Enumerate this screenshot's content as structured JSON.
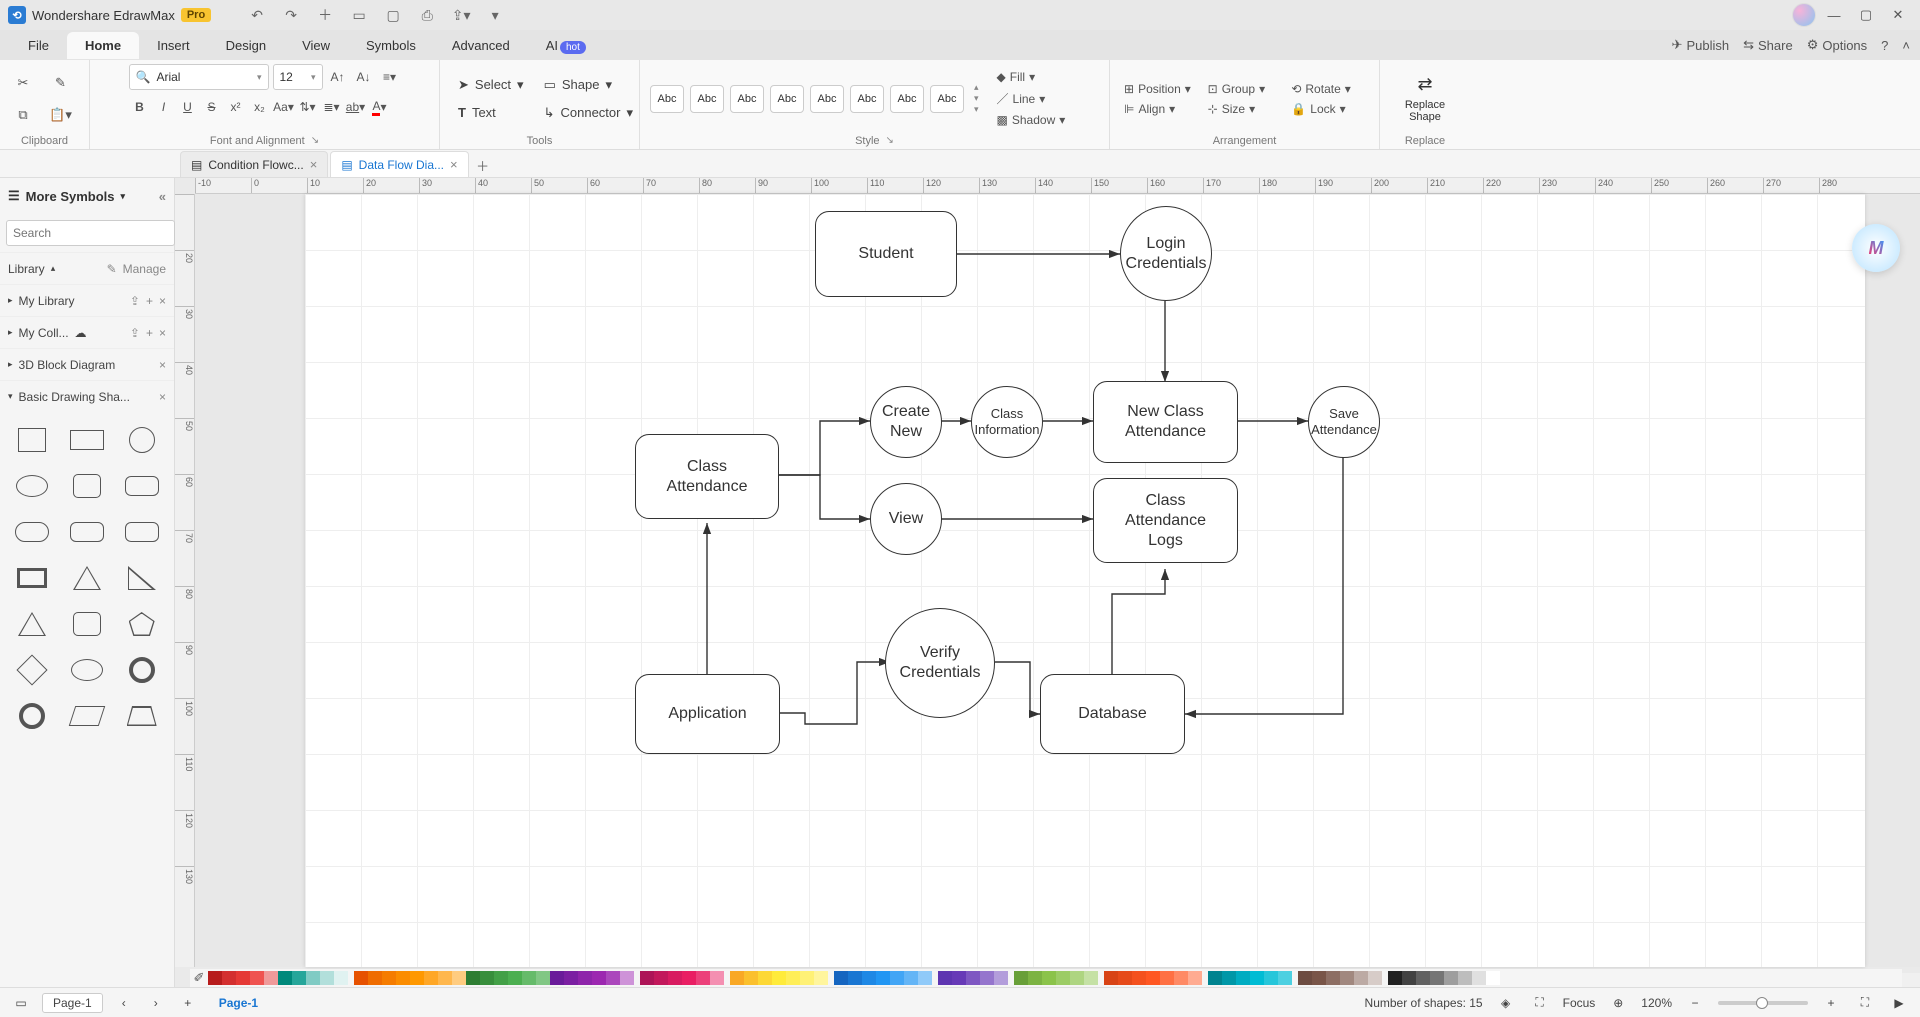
{
  "titlebar": {
    "app_name": "Wondershare EdrawMax",
    "badge": "Pro"
  },
  "menus": {
    "items": [
      "File",
      "Home",
      "Insert",
      "Design",
      "View",
      "Symbols",
      "Advanced",
      "AI"
    ],
    "active_index": 1,
    "ai_badge": "hot",
    "right": {
      "publish": "Publish",
      "share": "Share",
      "options": "Options"
    }
  },
  "ribbon": {
    "clipboard_label": "Clipboard",
    "font": {
      "name": "Arial",
      "size": "12",
      "label": "Font and Alignment"
    },
    "tools": {
      "select": "Select",
      "shape": "Shape",
      "text": "Text",
      "connector": "Connector",
      "label": "Tools"
    },
    "style": {
      "items": [
        "Abc",
        "Abc",
        "Abc",
        "Abc",
        "Abc",
        "Abc",
        "Abc",
        "Abc"
      ],
      "fill": "Fill",
      "line": "Line",
      "shadow": "Shadow",
      "label": "Style"
    },
    "arrange": {
      "position": "Position",
      "align": "Align",
      "group": "Group",
      "size": "Size",
      "rotate": "Rotate",
      "lock": "Lock",
      "label": "Arrangement"
    },
    "replace": {
      "btn": "Replace\nShape",
      "label": "Replace"
    }
  },
  "doc_tabs": {
    "tabs": [
      {
        "label": "Condition Flowc...",
        "active": false
      },
      {
        "label": "Data Flow Dia...",
        "active": true
      }
    ]
  },
  "sidepanel": {
    "title": "More Symbols",
    "search_placeholder": "Search",
    "search_btn": "Search",
    "library": "Library",
    "manage": "Manage",
    "sections": [
      "My Library",
      "My Coll...",
      "3D Block Diagram",
      "Basic Drawing Sha..."
    ]
  },
  "ruler_h": [
    "-10",
    "0",
    "10",
    "20",
    "30",
    "40",
    "50",
    "60",
    "70",
    "80",
    "90",
    "100",
    "110",
    "120",
    "130",
    "140",
    "150",
    "160",
    "170",
    "180",
    "190",
    "200",
    "210",
    "220",
    "230",
    "240",
    "250",
    "260",
    "270",
    "280"
  ],
  "ruler_v": [
    "",
    "20",
    "30",
    "40",
    "50",
    "60",
    "70",
    "80",
    "90",
    "100",
    "110",
    "120",
    "130"
  ],
  "diagram": {
    "student": "Student",
    "login": "Login\nCredentials",
    "class_attendance": "Class\nAttendance",
    "create_new": "Create\nNew",
    "class_info": "Class\nInformation",
    "new_class_att": "New Class\nAttendance",
    "save_att": "Save\nAttendance",
    "view": "View",
    "logs": "Class\nAttendance\nLogs",
    "application": "Application",
    "verify": "Verify\nCredentials",
    "database": "Database"
  },
  "colorbar": {
    "colors": [
      "#b71c1c",
      "#d32f2f",
      "#e53935",
      "#ef5350",
      "#ef9a9a",
      "#00897b",
      "#26a69a",
      "#80cbc4",
      "#b2dfdb",
      "#e0f2f1",
      "",
      "#e65100",
      "#ef6c00",
      "#f57c00",
      "#fb8c00",
      "#ff9800",
      "#ffa726",
      "#ffb74d",
      "#ffcc80",
      "#2e7d32",
      "#388e3c",
      "#43a047",
      "#4caf50",
      "#66bb6a",
      "#81c784",
      "#6a1b9a",
      "#7b1fa2",
      "#8e24aa",
      "#9c27b0",
      "#ab47bc",
      "#ce93d8",
      "",
      "#ad1457",
      "#c2185b",
      "#d81b60",
      "#e91e63",
      "#ec407a",
      "#f48fb1",
      "",
      "#f9a825",
      "#fbc02d",
      "#fdd835",
      "#ffeb3b",
      "#ffee58",
      "#fff176",
      "#fff59d",
      "",
      "#1565c0",
      "#1976d2",
      "#1e88e5",
      "#2196f3",
      "#42a5f5",
      "#64b5f6",
      "#90caf9",
      "",
      "#5e35b1",
      "#673ab7",
      "#7e57c2",
      "#9575cd",
      "#b39ddb",
      "",
      "#689f38",
      "#7cb342",
      "#8bc34a",
      "#9ccc65",
      "#aed581",
      "#c5e1a5",
      "",
      "#d84315",
      "#e64a19",
      "#f4511e",
      "#ff5722",
      "#ff7043",
      "#ff8a65",
      "#ffab91",
      "",
      "#00838f",
      "#0097a7",
      "#00acc1",
      "#00bcd4",
      "#26c6da",
      "#4dd0e1",
      "",
      "#6d4c41",
      "#795548",
      "#8d6e63",
      "#a1887f",
      "#bcaaa4",
      "#d7ccc8",
      "",
      "#212121",
      "#424242",
      "#616161",
      "#757575",
      "#9e9e9e",
      "#bdbdbd",
      "#e0e0e0",
      "#ffffff"
    ]
  },
  "statusbar": {
    "page_tab": "Page-1",
    "active_page": "Page-1",
    "shapes": "Number of shapes: 15",
    "focus": "Focus",
    "zoom": "120%"
  },
  "ai_float": "M"
}
